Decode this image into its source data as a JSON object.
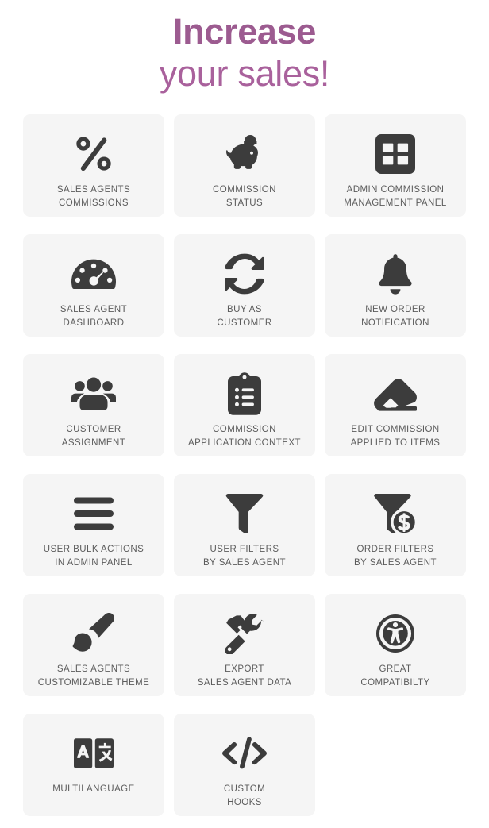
{
  "hero": {
    "line1": "Increase",
    "line2": "your sales!",
    "color_bold": "#9c5b90",
    "color_light": "#a9619c"
  },
  "theme": {
    "card_background": "#f5f5f5",
    "icon_color": "#3c3c3c",
    "label_color": "#5c5c5c",
    "page_background": "#ffffff"
  },
  "features": [
    {
      "icon": "percent-icon",
      "label": "SALES AGENTS\nCOMMISSIONS"
    },
    {
      "icon": "piggy-bank-icon",
      "label": "COMMISSION\nSTATUS"
    },
    {
      "icon": "table-grid-icon",
      "label": "ADMIN COMMISSION\nMANAGEMENT PANEL"
    },
    {
      "icon": "gauge-icon",
      "label": "SALES AGENT\nDASHBOARD"
    },
    {
      "icon": "sync-arrows-icon",
      "label": "BUY AS\nCUSTOMER"
    },
    {
      "icon": "bell-icon",
      "label": "NEW ORDER\nNOTIFICATION"
    },
    {
      "icon": "users-group-icon",
      "label": "CUSTOMER\nASSIGNMENT"
    },
    {
      "icon": "clipboard-list-icon",
      "label": "COMMISSION\nAPPLICATION CONTEXT"
    },
    {
      "icon": "eraser-icon",
      "label": "EDIT COMMISSION\nAPPLIED TO ITEMS"
    },
    {
      "icon": "bars-icon",
      "label": "USER BULK ACTIONS\nIN ADMIN PANEL"
    },
    {
      "icon": "funnel-icon",
      "label": "USER FILTERS\nBY SALES AGENT"
    },
    {
      "icon": "funnel-dollar-icon",
      "label": "ORDER FILTERS\nBY SALES AGENT"
    },
    {
      "icon": "paintbrush-icon",
      "label": "SALES AGENTS\nCUSTOMIZABLE THEME"
    },
    {
      "icon": "tools-icon",
      "label": "EXPORT\nSALES AGENT DATA"
    },
    {
      "icon": "accessibility-icon",
      "label": "GREAT\nCOMPATIBILTY"
    },
    {
      "icon": "translate-icon",
      "label": "MULTILANGUAGE"
    },
    {
      "icon": "code-brackets-icon",
      "label": "CUSTOM\nHOOKS"
    }
  ]
}
